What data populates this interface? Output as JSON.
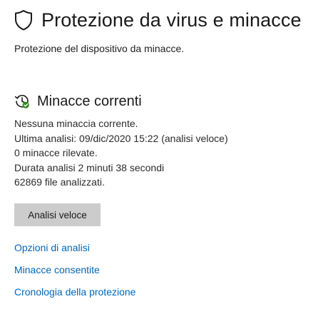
{
  "header": {
    "title": "Protezione da virus e minacce",
    "icon": "shield-icon"
  },
  "subtitle": "Protezione del dispositivo da minacce.",
  "current_threats": {
    "title": "Minacce correnti",
    "icon": "scan-history-icon",
    "status_color": "#2e8b1e",
    "lines": [
      "Nessuna minaccia corrente.",
      "Ultima analisi: 09/dic/2020 15:22 (analisi veloce)",
      "0 minacce rilevate.",
      "Durata analisi 2 minuti 38 secondi",
      "62869 file analizzati."
    ],
    "quick_scan_label": "Analisi veloce"
  },
  "links": [
    "Opzioni di analisi",
    "Minacce consentite",
    "Cronologia della protezione"
  ],
  "colors": {
    "link": "#0067b8",
    "button_bg": "#cccccc"
  }
}
